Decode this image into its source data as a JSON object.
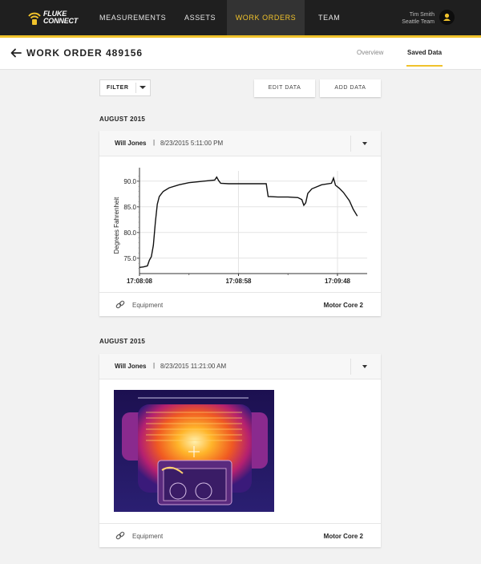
{
  "brand": {
    "logo_line1": "FLUKE",
    "logo_line2": "CONNECT",
    "accent": "#f0c22b",
    "logo_icon": "wifi-arc-icon"
  },
  "nav": {
    "items": [
      {
        "label": "MEASUREMENTS",
        "active": false
      },
      {
        "label": "ASSETS",
        "active": false
      },
      {
        "label": "WORK ORDERS",
        "active": true
      },
      {
        "label": "TEAM",
        "active": false
      }
    ]
  },
  "user": {
    "name": "Tim Smith",
    "team": "Seattle Team",
    "avatar_icon": "user-icon"
  },
  "header": {
    "back_icon": "arrow-left-icon",
    "title": "WORK ORDER 489156",
    "tabs": [
      {
        "label": "Overview",
        "active": false
      },
      {
        "label": "Saved Data",
        "active": true
      }
    ]
  },
  "toolbar": {
    "filter_label": "FILTER",
    "edit_label": "EDIT DATA",
    "add_label": "ADD DATA"
  },
  "records": [
    {
      "date_heading": "AUGUST 2015",
      "author": "Will Jones",
      "separator": "|",
      "timestamp": "8/23/2015  5:11:00 PM",
      "footer_label": "Equipment",
      "footer_value": "Motor Core 2",
      "footer_icon": "link-icon"
    },
    {
      "date_heading": "AUGUST 2015",
      "author": "Will Jones",
      "separator": "|",
      "timestamp": "8/23/2015  11:21:00 AM",
      "footer_label": "Equipment",
      "footer_value": "Motor Core 2",
      "footer_icon": "link-icon"
    }
  ],
  "chart_data": {
    "type": "line",
    "ylabel": "Degrees Fahrenheit",
    "xlabel": "",
    "title": "",
    "ylim": [
      72,
      92
    ],
    "yticks": [
      75.0,
      80.0,
      85.0,
      90.0
    ],
    "ytick_labels": [
      "75.0",
      "80.0",
      "85.0",
      "90.0"
    ],
    "xtick_labels": [
      "17:08:08",
      "17:08:58",
      "17:09:48"
    ],
    "xlim_seconds": [
      0,
      115
    ],
    "xtick_seconds": [
      0,
      50,
      100
    ],
    "grid": true,
    "series": [
      {
        "points": [
          [
            0,
            73.2
          ],
          [
            2,
            73.3
          ],
          [
            4,
            73.5
          ],
          [
            5,
            74.6
          ],
          [
            6,
            75.3
          ],
          [
            7,
            77.5
          ],
          [
            8,
            82
          ],
          [
            9,
            85.5
          ],
          [
            10,
            87
          ],
          [
            12,
            88
          ],
          [
            15,
            88.7
          ],
          [
            20,
            89.3
          ],
          [
            25,
            89.7
          ],
          [
            30,
            89.9
          ],
          [
            35,
            90.1
          ],
          [
            38,
            90.2
          ],
          [
            39,
            90.8
          ],
          [
            40,
            90.1
          ],
          [
            41,
            89.6
          ],
          [
            45,
            89.5
          ],
          [
            50,
            89.5
          ],
          [
            55,
            89.5
          ],
          [
            60,
            89.5
          ],
          [
            64,
            89.5
          ],
          [
            65,
            87.0
          ],
          [
            70,
            86.9
          ],
          [
            75,
            86.9
          ],
          [
            80,
            86.8
          ],
          [
            82,
            86.4
          ],
          [
            83,
            85.3
          ],
          [
            84,
            85.8
          ],
          [
            85,
            87.6
          ],
          [
            87,
            88.5
          ],
          [
            92,
            89.3
          ],
          [
            97,
            89.6
          ],
          [
            98,
            90.6
          ],
          [
            99,
            89.2
          ],
          [
            101,
            88.6
          ],
          [
            103,
            87.8
          ],
          [
            106,
            86.2
          ],
          [
            108,
            84.5
          ],
          [
            110,
            83.2
          ]
        ]
      }
    ]
  }
}
